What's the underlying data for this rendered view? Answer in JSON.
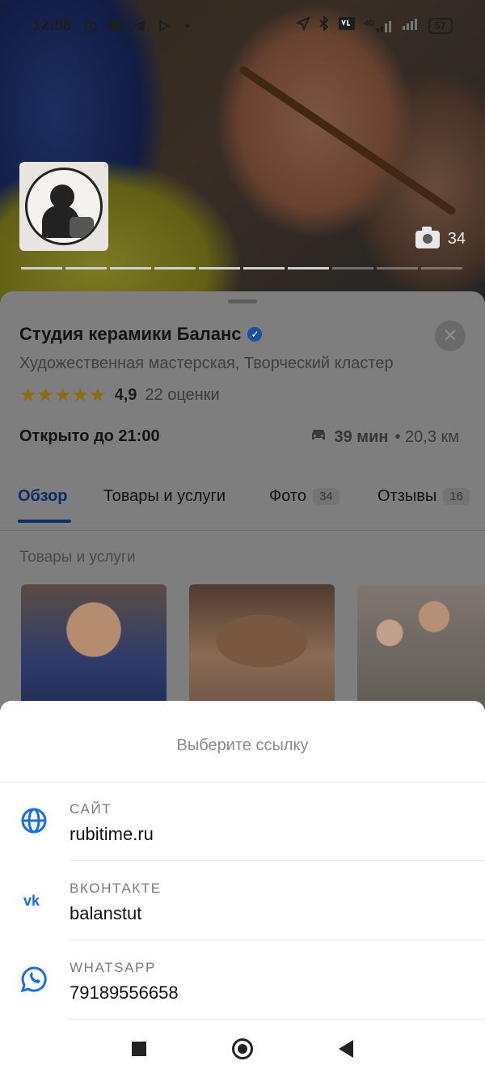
{
  "status_bar": {
    "time": "12:08",
    "network": "4G",
    "battery": "57"
  },
  "hero": {
    "photo_count": "34",
    "photo_slides": 10,
    "active_slide": 7
  },
  "place": {
    "name": "Студия керамики Баланс",
    "categories": "Художественная мастерская, Творческий кластер",
    "rating": "4,9",
    "rating_stars": 5,
    "reviews_count": "22 оценки",
    "hours": "Открыто до 21:00",
    "drive_time": "39 мин",
    "distance": "• 20,3 км"
  },
  "tabs": [
    {
      "label": "Обзор",
      "badge": ""
    },
    {
      "label": "Товары и услуги",
      "badge": ""
    },
    {
      "label": "Фото",
      "badge": "34"
    },
    {
      "label": "Отзывы",
      "badge": "16"
    }
  ],
  "section": {
    "label": "Товары и услуги"
  },
  "sheet": {
    "title": "Выберите ссылку",
    "links": [
      {
        "label": "САЙТ",
        "value": "rubitime.ru",
        "icon": "globe-icon",
        "color": "#1b6fd8"
      },
      {
        "label": "ВКОНТАКТЕ",
        "value": "balanstut",
        "icon": "vk-icon",
        "color": "#1b6fd8"
      },
      {
        "label": "WHATSAPP",
        "value": "79189556658",
        "icon": "whatsapp-icon",
        "color": "#1b6fd8"
      }
    ]
  },
  "colors": {
    "accent": "#1b6fd8",
    "star": "#f5c518",
    "verified": "#2f7de1"
  }
}
